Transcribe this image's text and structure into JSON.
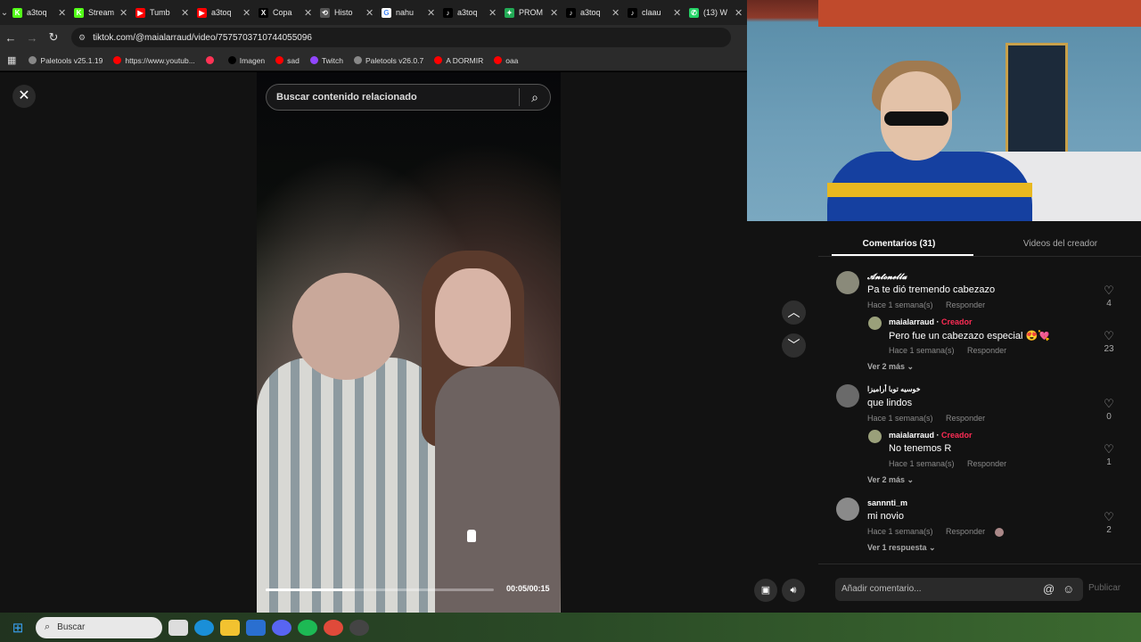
{
  "browser": {
    "tabs": [
      {
        "title": "a3toq",
        "fav": "K",
        "color": "#53fc18"
      },
      {
        "title": "Stream",
        "fav": "K",
        "color": "#53fc18"
      },
      {
        "title": "Tumb",
        "fav": "▶",
        "color": "#ff0000"
      },
      {
        "title": "a3toq",
        "fav": "▶",
        "color": "#ff0000"
      },
      {
        "title": "Copa",
        "fav": "X",
        "color": "#000000"
      },
      {
        "title": "Histo",
        "fav": "⟲",
        "color": "#555555"
      },
      {
        "title": "nahu",
        "fav": "G",
        "color": "#ffffff"
      },
      {
        "title": "a3toq",
        "fav": "♪",
        "color": "#000000"
      },
      {
        "title": "PROM",
        "fav": "✦",
        "color": "#22aa55"
      },
      {
        "title": "a3toq",
        "fav": "♪",
        "color": "#000000"
      },
      {
        "title": "claau",
        "fav": "♪",
        "color": "#000000"
      },
      {
        "title": "(13) W",
        "fav": "✆",
        "color": "#25d366"
      }
    ],
    "url": "tiktok.com/@maialarraud/video/7575703710744055096",
    "bookmarks": [
      {
        "label": "Paletools v25.1.19",
        "color": "#888888"
      },
      {
        "label": "https://www.youtub...",
        "color": "#ff0000"
      },
      {
        "label": "",
        "color": "#ff3355"
      },
      {
        "label": "Imagen",
        "color": "#000000"
      },
      {
        "label": "sad",
        "color": "#ff0000"
      },
      {
        "label": "Twitch",
        "color": "#9146ff"
      },
      {
        "label": "Paletools v26.0.7",
        "color": "#888888"
      },
      {
        "label": "A DORMIR",
        "color": "#ff0000"
      },
      {
        "label": "oaa",
        "color": "#ff0000"
      }
    ]
  },
  "player": {
    "search_placeholder": "Buscar contenido relacionado",
    "timecode": "00:05/00:15",
    "progress": 0.39
  },
  "comments_panel": {
    "tab_comments": "Comentarios (31)",
    "tab_videos": "Videos del creador",
    "reply_label": "Responder",
    "creator_label": "Creador",
    "comments": [
      {
        "user": "𝓐𝓷𝓽𝓸𝓷𝓮𝓵𝓵𝓪",
        "text": "Pa te dió tremendo cabezazo",
        "time": "Hace 1 semana(s)",
        "likes": "4"
      },
      {
        "user": "maialarraud",
        "text": "Pero fue un cabezazo especial 😍💘",
        "time": "Hace 1 semana(s)",
        "likes": "23"
      },
      {
        "user": "خوسيه توبا أراميزا",
        "text": "que lindos",
        "time": "Hace 1 semana(s)",
        "likes": "0"
      },
      {
        "user": "maialarraud",
        "text": "No tenemos R",
        "time": "Hace 1 semana(s)",
        "likes": "1"
      },
      {
        "user": "sannnti_m",
        "text": "mi novio",
        "time": "Hace 1 semana(s)",
        "likes": "2"
      }
    ],
    "more_1": "Ver 2 más",
    "more_2": "Ver 2 más",
    "more_3": "Ver 1 respuesta",
    "composer_placeholder": "Añadir comentario...",
    "publish_label": "Publicar"
  },
  "taskbar": {
    "search_placeholder": "Buscar"
  }
}
